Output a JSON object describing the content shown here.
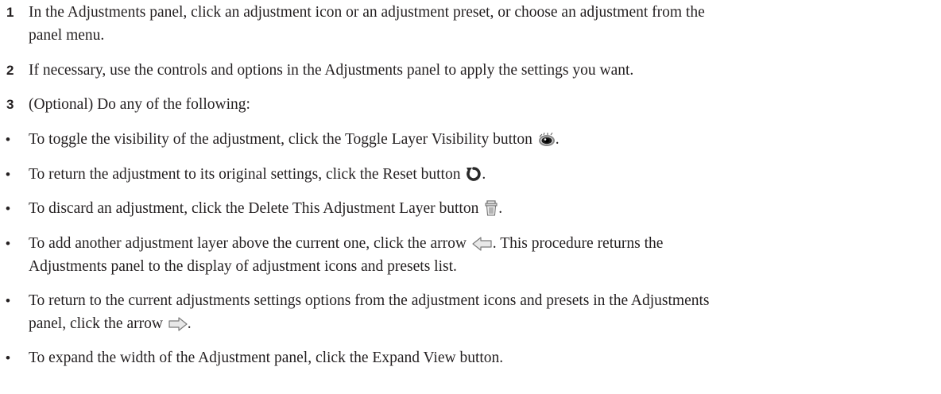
{
  "steps": [
    {
      "number": "1",
      "line1": "In the Adjustments panel, click an adjustment icon or an adjustment preset, or choose an adjustment from the",
      "line2": "panel menu."
    },
    {
      "number": "2",
      "text": "If necessary, use the controls and options in the Adjustments panel to apply the settings you want."
    },
    {
      "number": "3",
      "text": "(Optional) Do any of the following:"
    }
  ],
  "bullets": {
    "marker": "•",
    "toggle_visibility": {
      "before": "To toggle the visibility of the adjustment, click the Toggle Layer Visibility button",
      "after": ".",
      "icon": "eye-icon"
    },
    "reset": {
      "before": "To return the adjustment to its original settings, click the Reset button",
      "after": ".",
      "icon": "reset-icon"
    },
    "delete": {
      "before": "To discard an adjustment, click the Delete This Adjustment Layer button",
      "after": ".",
      "icon": "trash-icon"
    },
    "add_layer": {
      "before": "To add another adjustment layer above the current one, click the arrow",
      "after": ". This procedure returns the",
      "line2": "Adjustments panel to the display of adjustment icons and presets list.",
      "icon": "left-arrow-icon"
    },
    "return_settings": {
      "line1": "To return to the current adjustments settings options from the adjustment icons and presets in the Adjustments",
      "before": "panel, click the arrow",
      "after": ".",
      "icon": "right-arrow-icon"
    },
    "expand": {
      "text": "To expand the width of the Adjustment panel, click the Expand View button."
    }
  }
}
